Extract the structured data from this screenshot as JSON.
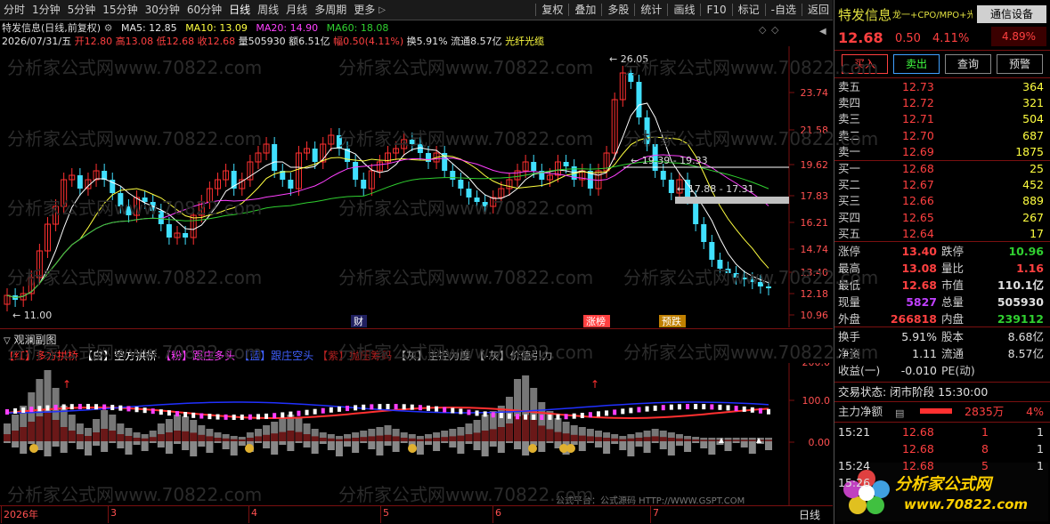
{
  "toolbar": {
    "periods": [
      "分时",
      "1分钟",
      "5分钟",
      "15分钟",
      "30分钟",
      "60分钟",
      "日线",
      "周线",
      "月线",
      "多周期",
      "更多"
    ],
    "actions": [
      "复权",
      "叠加",
      "多股",
      "统计",
      "画线",
      "F10",
      "标记",
      "-自选",
      "返回"
    ]
  },
  "info": {
    "stock_label": "特发信息(日线,前复权)",
    "ma5_label": "MA5: 12.85",
    "ma10_label": "MA10: 13.09",
    "ma20_label": "MA20: 14.90",
    "ma60_label": "MA60: 18.08",
    "date": "2026/07/31/五",
    "open": "开12.80",
    "high": "高13.08",
    "low": "低12.68",
    "close": "收12.68",
    "volume": "量505930",
    "amount": "额6.51亿",
    "amplitude": "幅0.50(4.11%)",
    "turnover": "换5.91%",
    "float": "流通8.57亿",
    "concept": "光纤光缆"
  },
  "main_chart": {
    "price_ticks": [
      "23.74",
      "21.58",
      "19.62",
      "17.83",
      "16.21",
      "14.74",
      "13.40",
      "12.18",
      "10.96"
    ],
    "annotations": {
      "peak": "26.05",
      "low": "11.00",
      "range1": "19.39 - 19.33",
      "range2": "17.88 - 17.31"
    },
    "event_labels": [
      "财",
      "涨榜",
      "预跌"
    ]
  },
  "sub_chart": {
    "title": "观澜副图",
    "legend": [
      {
        "tag": "【红】",
        "text": "多方拱桥",
        "color": "#ff3030"
      },
      {
        "tag": "【白】",
        "text": "空方拱桥",
        "color": "#ffffff"
      },
      {
        "tag": "【粉】",
        "text": "跟庄多头",
        "color": "#ff40ff"
      },
      {
        "tag": "【蓝】",
        "text": "跟庄空头",
        "color": "#4060ff"
      },
      {
        "tag": "【紫】",
        "text": "抛压筹码",
        "color": "#b02020"
      },
      {
        "tag": "【灰】",
        "text": "主控力度",
        "color": "#a0a0a0"
      },
      {
        "tag": "【-灰】",
        "text": "价值引力",
        "color": "#a0a0a0"
      }
    ],
    "ticks": [
      "200.0",
      "100.0",
      "0.00"
    ]
  },
  "dates": [
    "2026年",
    "3",
    "4",
    "5",
    "6",
    "7"
  ],
  "bottom_mode": "日线",
  "watermark": "分析家公式网www.70822.com",
  "source_credit": "公式平台：公式源码 HTTP://WWW.GSPT.COM",
  "right_panel": {
    "name": "特发信息",
    "tags": "龙一+CPO/MPO+光纤概",
    "comm": "通信设备",
    "price": "12.68",
    "change": "0.50",
    "change_pct": "4.11%",
    "swing": "4.89%",
    "buttons": [
      "买入",
      "卖出",
      "查询",
      "预警"
    ],
    "asks": [
      {
        "label": "卖五",
        "price": "12.73",
        "vol": "364"
      },
      {
        "label": "卖四",
        "price": "12.72",
        "vol": "321"
      },
      {
        "label": "卖三",
        "price": "12.71",
        "vol": "504"
      },
      {
        "label": "卖二",
        "price": "12.70",
        "vol": "687"
      },
      {
        "label": "卖一",
        "price": "12.69",
        "vol": "1875"
      }
    ],
    "bids": [
      {
        "label": "买一",
        "price": "12.68",
        "vol": "25"
      },
      {
        "label": "买二",
        "price": "12.67",
        "vol": "452"
      },
      {
        "label": "买三",
        "price": "12.66",
        "vol": "889"
      },
      {
        "label": "买四",
        "price": "12.65",
        "vol": "267"
      },
      {
        "label": "买五",
        "price": "12.64",
        "vol": "17"
      }
    ],
    "stats": [
      {
        "l1": "涨停",
        "v1": "13.40",
        "c1": "#ff4040",
        "l2": "跌停",
        "v2": "10.96",
        "c2": "#30d030"
      },
      {
        "l1": "最高",
        "v1": "13.08",
        "c1": "#ff4040",
        "l2": "量比",
        "v2": "1.16",
        "c2": "#ff4040"
      },
      {
        "l1": "最低",
        "v1": "12.68",
        "c1": "#ff4040",
        "l2": "市值",
        "v2": "110.1亿",
        "c2": "#e0e0e0"
      },
      {
        "l1": "现量",
        "v1": "5827",
        "c1": "#c040ff",
        "l2": "总量",
        "v2": "505930",
        "c2": "#e0e0e0"
      },
      {
        "l1": "外盘",
        "v1": "266818",
        "c1": "#ff4040",
        "l2": "内盘",
        "v2": "239112",
        "c2": "#30d030"
      }
    ],
    "stats2": [
      {
        "l1": "换手",
        "v1": "5.91%",
        "l2": "股本",
        "v2": "8.68亿"
      },
      {
        "l1": "净资",
        "v1": "1.11",
        "l2": "流通",
        "v2": "8.57亿"
      },
      {
        "l1": "收益(一)",
        "v1": "-0.010",
        "l2": "PE(动)",
        "v2": ""
      }
    ],
    "trade_status": "交易状态: 闭市阶段 15:30:00",
    "net_flow_label": "主力净额",
    "net_flow_value": "2835万",
    "net_flow_pct": "4%",
    "ticks": [
      {
        "time": "15:21",
        "price": "12.68",
        "vol": "1",
        "n": "1"
      },
      {
        "time": "",
        "price": "12.68",
        "vol": "8",
        "n": "1"
      },
      {
        "time": "15:24",
        "price": "12.68",
        "vol": "5",
        "n": "1"
      },
      {
        "time": "15:26",
        "price": "",
        "vol": "",
        "n": ""
      }
    ],
    "logo_text": "分析家公式网",
    "logo_url": "www.70822.com"
  }
}
